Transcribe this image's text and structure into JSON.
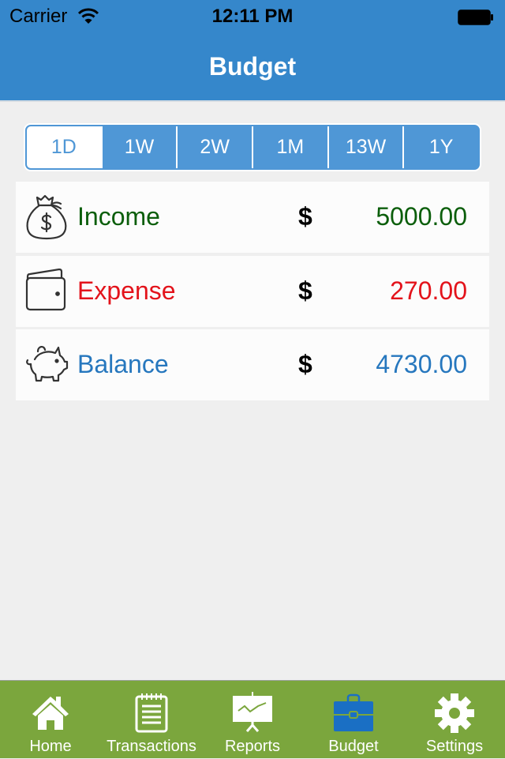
{
  "status_bar": {
    "carrier": "Carrier",
    "time": "12:11 PM",
    "wifi_icon": "wifi-icon",
    "battery_icon": "battery-full-icon"
  },
  "nav": {
    "title": "Budget"
  },
  "period_selector": {
    "selected": "1D",
    "options": [
      "1D",
      "1W",
      "2W",
      "1M",
      "13W",
      "1Y"
    ]
  },
  "summary": {
    "rows": [
      {
        "label": "Income",
        "icon": "money-bag-icon",
        "currency": "$",
        "amount": "5000.00",
        "color": "#0b5e0b"
      },
      {
        "label": "Expense",
        "icon": "wallet-icon",
        "currency": "$",
        "amount": "270.00",
        "color": "#e3131b"
      },
      {
        "label": "Balance",
        "icon": "piggy-bank-icon",
        "currency": "$",
        "amount": "4730.00",
        "color": "#2677be"
      }
    ]
  },
  "tabbar": {
    "selected": "Budget",
    "items": [
      {
        "label": "Home",
        "icon": "home-icon"
      },
      {
        "label": "Transactions",
        "icon": "notepad-icon"
      },
      {
        "label": "Reports",
        "icon": "presentation-chart-icon"
      },
      {
        "label": "Budget",
        "icon": "briefcase-icon"
      },
      {
        "label": "Settings",
        "icon": "gear-icon"
      }
    ]
  },
  "colors": {
    "header": "#3587cb",
    "segment_accent": "#4f97d6",
    "tabbar": "#7ba63d",
    "tab_active_icon": "#1a6fc4",
    "income": "#0b5e0b",
    "expense": "#e3131b",
    "balance": "#2677be"
  }
}
